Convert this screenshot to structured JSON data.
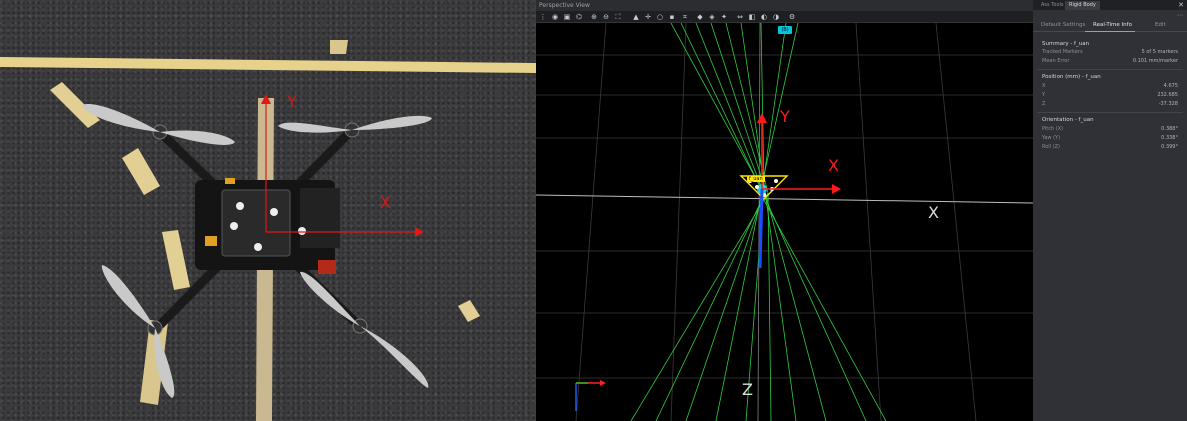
{
  "photo": {
    "axis_x_label": "X",
    "axis_y_label": "Y"
  },
  "viewport": {
    "title": "Perspective View",
    "asset_badge": "(B)",
    "rigid_body_tag": "f_uan",
    "axis_x_label": "X",
    "axis_y_label": "Y",
    "grid_x_label": "X",
    "grid_z_label": "Z",
    "ray_color": "#2ecc40",
    "x_axis_color": "#ff1a1a",
    "y_axis_color": "#ff1a1a"
  },
  "panel": {
    "tabs": [
      {
        "label": "Ass Tools"
      },
      {
        "label": "Rigid Body"
      }
    ],
    "subtabs": [
      {
        "label": "Default Settings"
      },
      {
        "label": "Real-Time Info"
      },
      {
        "label": "Edit"
      }
    ],
    "summary": {
      "title": "Summary - f_uan",
      "rows": [
        {
          "label": "Tracked Markers",
          "value": "5 of 5 markers"
        },
        {
          "label": "Mean Error",
          "value": "0.101 mm/marker"
        }
      ]
    },
    "position": {
      "title": "Position (mm) - f_uan",
      "rows": [
        {
          "label": "X",
          "value": "4.675"
        },
        {
          "label": "Y",
          "value": "232.685"
        },
        {
          "label": "Z",
          "value": "-37.328"
        }
      ]
    },
    "orientation": {
      "title": "Orientation - f_uan",
      "rows": [
        {
          "label": "Pitch (X)",
          "value": "0.388°"
        },
        {
          "label": "Yaw (Y)",
          "value": "0.338°"
        },
        {
          "label": "Roll (Z)",
          "value": "0.399°"
        }
      ]
    }
  }
}
